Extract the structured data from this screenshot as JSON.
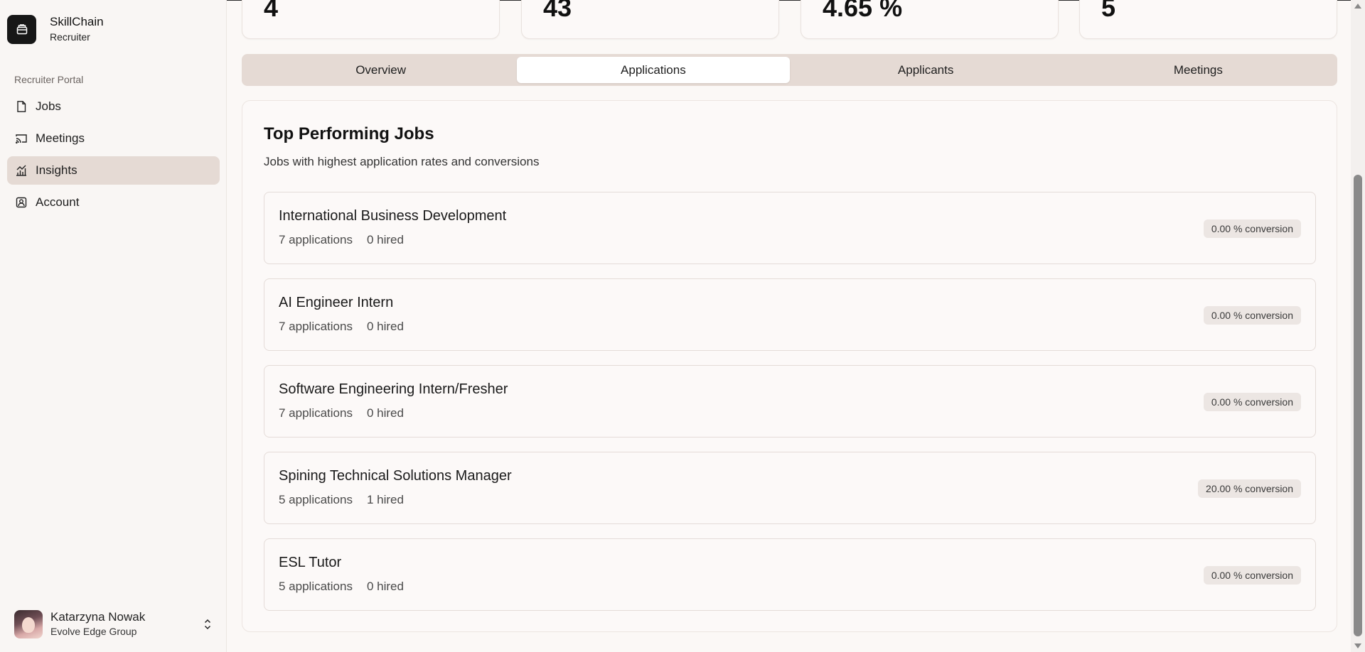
{
  "brand": {
    "name": "SkillChain",
    "role": "Recruiter",
    "logo_icon": "briefcase-icon"
  },
  "sidebar": {
    "section_label": "Recruiter Portal",
    "items": [
      {
        "label": "Jobs",
        "icon": "file-icon",
        "active": false
      },
      {
        "label": "Meetings",
        "icon": "cast-icon",
        "active": false
      },
      {
        "label": "Insights",
        "icon": "chart-icon",
        "active": true
      },
      {
        "label": "Account",
        "icon": "contact-icon",
        "active": false
      }
    ]
  },
  "user": {
    "name": "Katarzyna Nowak",
    "org": "Evolve Edge Group"
  },
  "stats": [
    {
      "value": "4"
    },
    {
      "value": "43"
    },
    {
      "value": "4.65 %"
    },
    {
      "value": "5"
    }
  ],
  "tabs": [
    {
      "label": "Overview",
      "active": false
    },
    {
      "label": "Applications",
      "active": true
    },
    {
      "label": "Applicants",
      "active": false
    },
    {
      "label": "Meetings",
      "active": false
    }
  ],
  "panel": {
    "title": "Top Performing Jobs",
    "subtitle": "Jobs with highest application rates and conversions",
    "jobs": [
      {
        "title": "International Business Development",
        "applications": "7 applications",
        "hired": "0 hired",
        "conversion": "0.00 % conversion"
      },
      {
        "title": "AI Engineer Intern",
        "applications": "7 applications",
        "hired": "0 hired",
        "conversion": "0.00 % conversion"
      },
      {
        "title": "Software Engineering Intern/Fresher",
        "applications": "7 applications",
        "hired": "0 hired",
        "conversion": "0.00 % conversion"
      },
      {
        "title": "Spining Technical Solutions Manager",
        "applications": "5 applications",
        "hired": "1 hired",
        "conversion": "20.00 % conversion"
      },
      {
        "title": "ESL Tutor",
        "applications": "5 applications",
        "hired": "0 hired",
        "conversion": "0.00 % conversion"
      }
    ]
  },
  "colors": {
    "active_nav": "#e5dad4",
    "tab_bar": "#e5dad4",
    "background": "#fbf8f6"
  }
}
